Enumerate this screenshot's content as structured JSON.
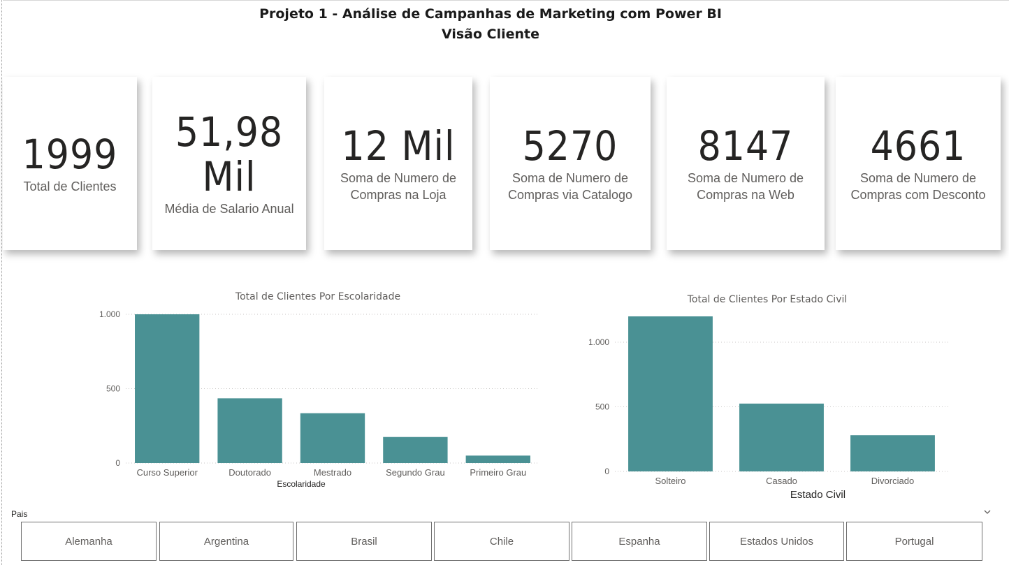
{
  "header": {
    "title_line1": "Projeto 1 - Análise de Campanhas de Marketing com Power BI",
    "title_line2": "Visão Cliente"
  },
  "cards": [
    {
      "value": "1999",
      "label": "Total de Clientes"
    },
    {
      "value": "51,98 Mil",
      "label": "Média de Salario Anual"
    },
    {
      "value": "12 Mil",
      "label": "Soma de Numero de Compras na Loja"
    },
    {
      "value": "5270",
      "label": "Soma de Numero de Compras via Catalogo"
    },
    {
      "value": "8147",
      "label": "Soma de Numero de Compras na Web"
    },
    {
      "value": "4661",
      "label": "Soma de Numero de Compras com Desconto"
    }
  ],
  "chart_data": [
    {
      "type": "bar",
      "title": "Total de Clientes Por Escolaridade",
      "xlabel": "Escolaridade",
      "ylabel": "",
      "categories": [
        "Curso Superior",
        "Doutorado",
        "Mestrado",
        "Segundo Grau",
        "Primeiro Grau"
      ],
      "values": [
        1000,
        435,
        335,
        175,
        50
      ],
      "ylim": [
        0,
        1000
      ],
      "yticks": [
        0,
        500,
        1000
      ],
      "ytick_labels": [
        "0",
        "500",
        "1.000"
      ],
      "grid": true,
      "color": "#4A9194"
    },
    {
      "type": "bar",
      "title": "Total de Clientes Por Estado Civil",
      "xlabel": "Estado Civil",
      "ylabel": "",
      "categories": [
        "Solteiro",
        "Casado",
        "Divorciado"
      ],
      "values": [
        1200,
        525,
        280
      ],
      "ylim": [
        0,
        1200
      ],
      "yticks": [
        0,
        500,
        1000
      ],
      "ytick_labels": [
        "0",
        "500",
        "1.000"
      ],
      "grid": true,
      "color": "#4A9194"
    }
  ],
  "slicer": {
    "label": "Pais",
    "options": [
      "Alemanha",
      "Argentina",
      "Brasil",
      "Chile",
      "Espanha",
      "Estados Unidos",
      "Portugal"
    ]
  }
}
